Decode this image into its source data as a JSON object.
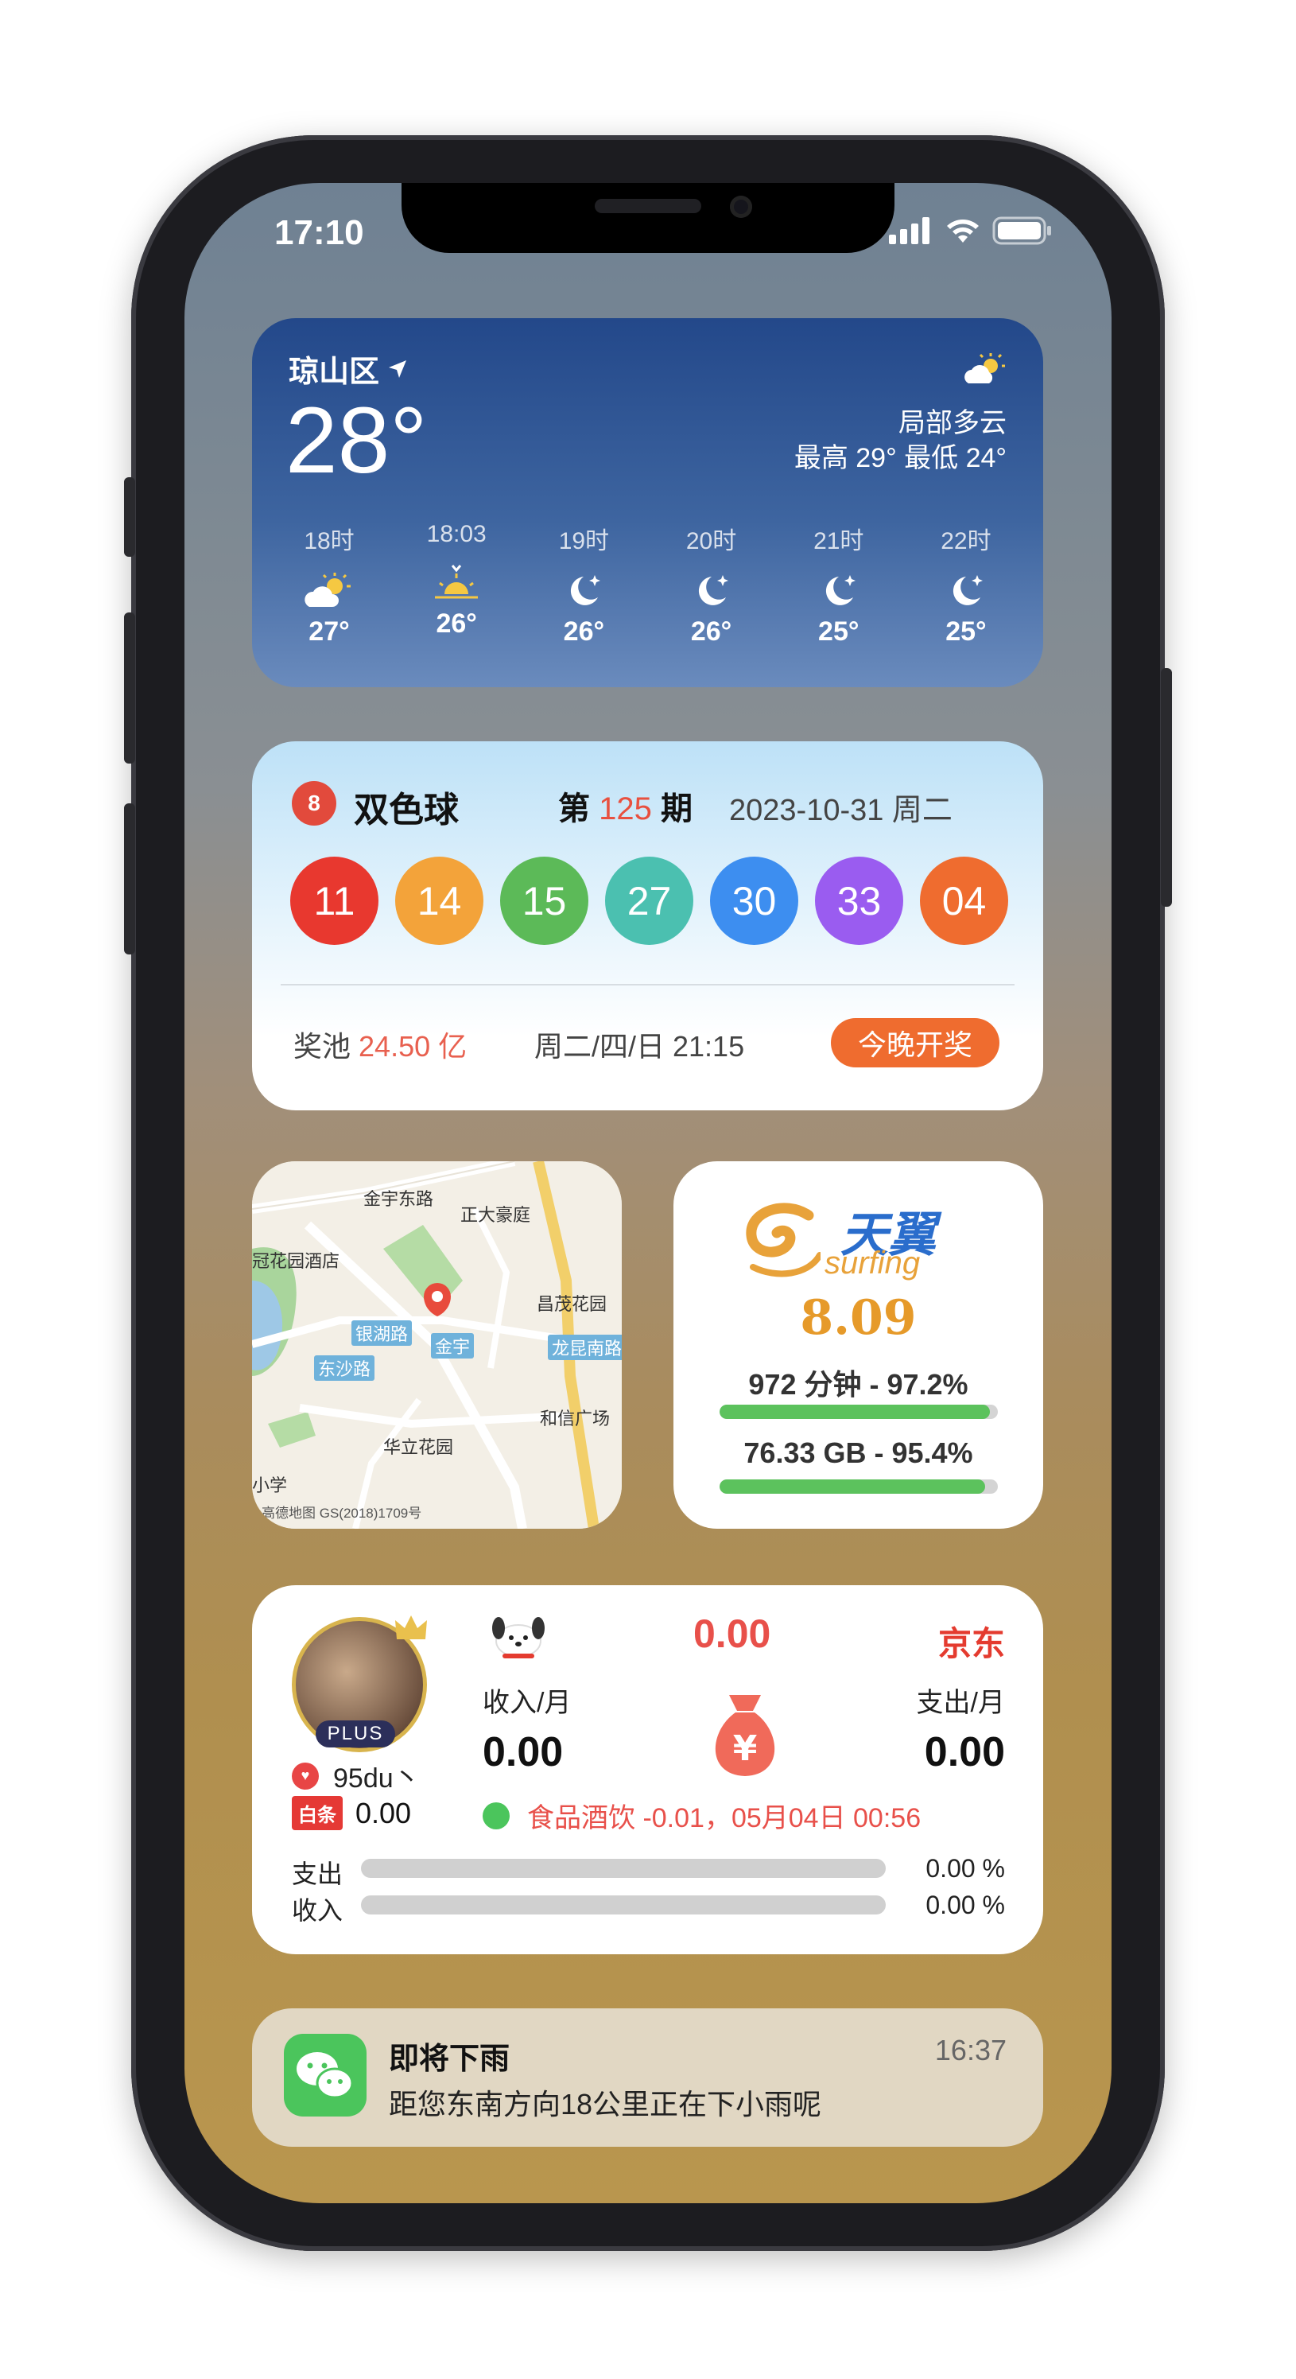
{
  "status": {
    "time": "17:10"
  },
  "weather": {
    "location": "琼山区",
    "temp": "28°",
    "condition": "局部多云",
    "range": "最高 29° 最低 24°",
    "hourly": [
      {
        "time": "18时",
        "icon": "partly-cloudy-sun-icon",
        "temp": "27°"
      },
      {
        "time": "18:03",
        "icon": "sunset-icon",
        "temp": "26°"
      },
      {
        "time": "19时",
        "icon": "moon-stars-icon",
        "temp": "26°"
      },
      {
        "time": "20时",
        "icon": "moon-stars-icon",
        "temp": "26°"
      },
      {
        "time": "21时",
        "icon": "moon-stars-icon",
        "temp": "25°"
      },
      {
        "time": "22时",
        "icon": "moon-stars-icon",
        "temp": "25°"
      }
    ]
  },
  "lottery": {
    "name": "双色球",
    "issue_prefix": "第",
    "issue_number": "125",
    "issue_suffix": "期",
    "date": "2023-10-31 周二",
    "balls": [
      {
        "value": "11",
        "color": "#e8382f"
      },
      {
        "value": "14",
        "color": "#f3a33a"
      },
      {
        "value": "15",
        "color": "#5cba58"
      },
      {
        "value": "27",
        "color": "#4bc0b0"
      },
      {
        "value": "30",
        "color": "#3d8ef0"
      },
      {
        "value": "33",
        "color": "#9a5cf0"
      },
      {
        "value": "04",
        "color": "#ef6c2f"
      }
    ],
    "pool_label": "奖池",
    "pool_amount": "24.50 亿",
    "schedule": "周二/四/日 21:15",
    "open_button": "今晚开奖"
  },
  "map": {
    "labels": [
      {
        "text": "金宇东路"
      },
      {
        "text": "正大豪庭"
      },
      {
        "text": "冠花园酒店"
      },
      {
        "text": "昌茂花园"
      },
      {
        "text": "银湖路"
      },
      {
        "text": "金宇"
      },
      {
        "text": "龙昆南路"
      },
      {
        "text": "东沙路"
      },
      {
        "text": "和信广场"
      },
      {
        "text": "华立花园"
      },
      {
        "text": "小学"
      },
      {
        "text": "高德地图 GS(2018)1709号"
      }
    ]
  },
  "telecom": {
    "brand_cn": "天翼",
    "brand_en": "surfing",
    "balance": "8.09",
    "voice": "972 分钟 - 97.2%",
    "voice_pct": 97.2,
    "data": "76.33 GB - 95.4%",
    "data_pct": 95.4
  },
  "jd": {
    "badge": "PLUS",
    "username": "95du丶",
    "baitiao_tag": "白条",
    "baitiao_value": "0.00",
    "total": "0.00",
    "brand": "京东",
    "income_label": "收入/月",
    "income_value": "0.00",
    "expense_label": "支出/月",
    "expense_value": "0.00",
    "last_tx": "食品酒饮 -0.01，05月04日 00:56",
    "expense_bar_label": "支出",
    "expense_bar_value": "0.00 %",
    "income_bar_label": "收入",
    "income_bar_value": "0.00 %"
  },
  "notification": {
    "title": "即将下雨",
    "time": "16:37",
    "body": "距您东南方向18公里正在下小雨呢"
  }
}
